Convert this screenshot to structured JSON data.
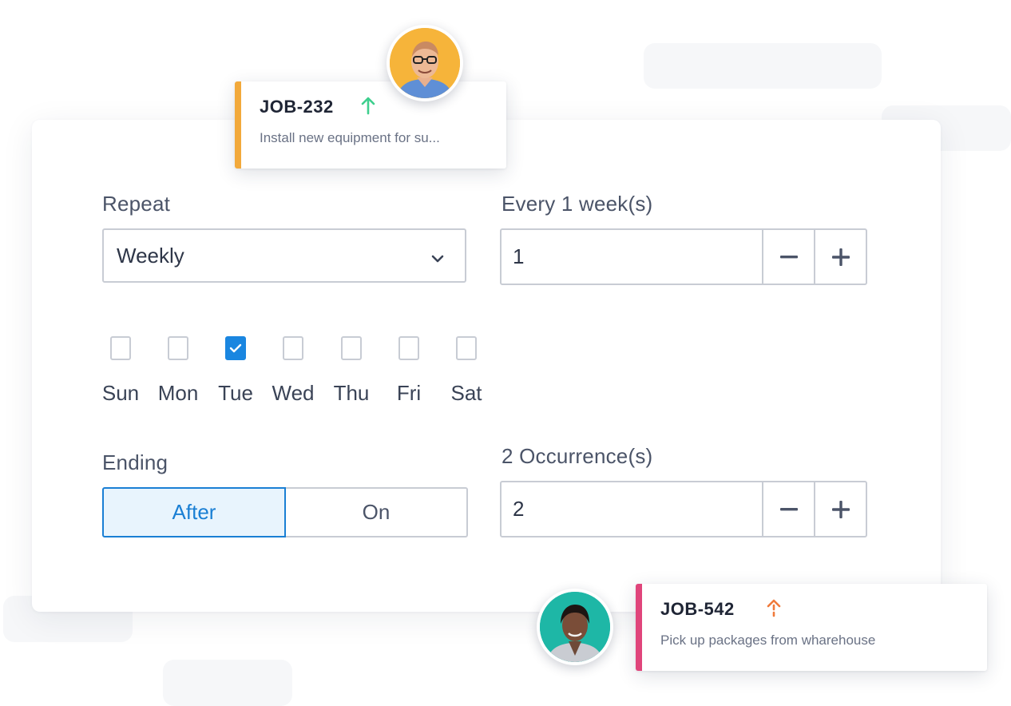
{
  "repeat": {
    "label": "Repeat",
    "selected": "Weekly",
    "icon": "chevron-down-icon"
  },
  "interval": {
    "label": "Every 1 week(s)",
    "value": "1",
    "decrement": "−",
    "increment": "+"
  },
  "days": [
    {
      "label": "Sun",
      "checked": false
    },
    {
      "label": "Mon",
      "checked": false
    },
    {
      "label": "Tue",
      "checked": true
    },
    {
      "label": "Wed",
      "checked": false
    },
    {
      "label": "Thu",
      "checked": false
    },
    {
      "label": "Fri",
      "checked": false
    },
    {
      "label": "Sat",
      "checked": false
    }
  ],
  "ending": {
    "label": "Ending",
    "options": [
      "After",
      "On"
    ],
    "selected": "After"
  },
  "occurrences": {
    "label": "2 Occurrence(s)",
    "value": "2",
    "decrement": "−",
    "increment": "+"
  },
  "jobs": [
    {
      "id": "JOB-232",
      "description": "Install new equipment for su...",
      "accent": "#f2a93b",
      "arrow_color": "#3ecf8e",
      "priority_icon": "arrow-up-icon"
    },
    {
      "id": "JOB-542",
      "description": "Pick up packages from wharehouse",
      "accent": "#e0457b",
      "arrow_color": "#f07a3a",
      "priority_icon": "arrow-up-dashed-icon"
    }
  ],
  "colors": {
    "primary": "#1a86e0",
    "selected_bg": "#e8f4fd"
  }
}
